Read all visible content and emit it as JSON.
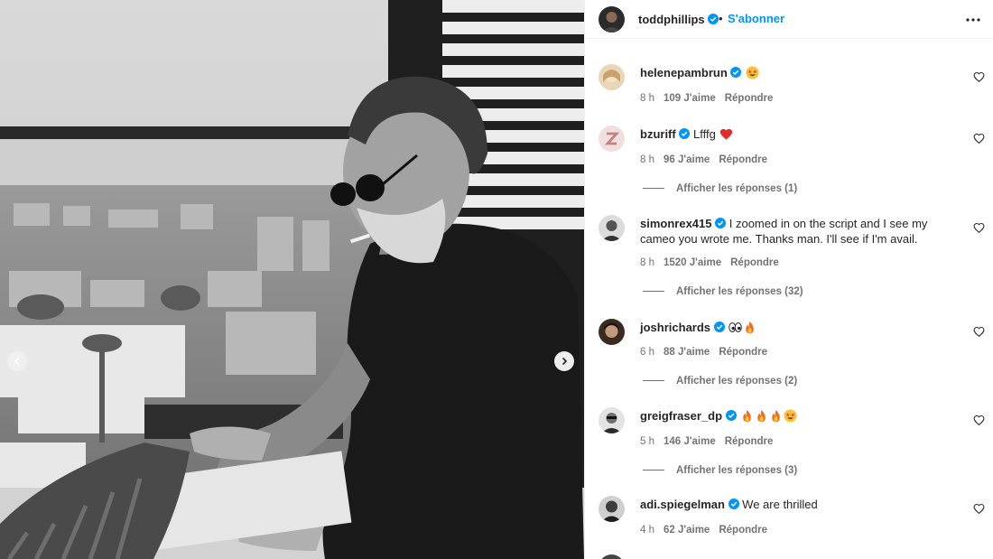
{
  "post": {
    "author": "toddphillips",
    "separator": "•",
    "follow_label": "S'abonner",
    "more_icon": "more-horizontal-icon",
    "carousel": {
      "prev_icon": "chevron-left-icon",
      "next_icon": "chevron-right-icon"
    }
  },
  "comments": [
    {
      "user": "helenepambrun",
      "verified": true,
      "text": "",
      "emojis": [
        "star-struck"
      ],
      "time": "8 h",
      "likes": "109 J'aime",
      "reply": "Répondre",
      "replies": ""
    },
    {
      "user": "bzuriff",
      "verified": true,
      "text": "Lfffg",
      "emojis": [
        "red-heart"
      ],
      "time": "8 h",
      "likes": "96 J'aime",
      "reply": "Répondre",
      "replies": "Afficher les réponses (1)"
    },
    {
      "user": "simonrex415",
      "verified": true,
      "text": "I zoomed in on the script and I see my cameo you wrote me. Thanks man. I'll see if I'm avail.",
      "emojis": [],
      "time": "8 h",
      "likes": "1520 J'aime",
      "reply": "Répondre",
      "replies": "Afficher les réponses (32)"
    },
    {
      "user": "joshrichards",
      "verified": true,
      "text": "",
      "emojis": [
        "eyes",
        "fire"
      ],
      "time": "6 h",
      "likes": "88 J'aime",
      "reply": "Répondre",
      "replies": "Afficher les réponses (2)"
    },
    {
      "user": "greigfraser_dp",
      "verified": true,
      "text": "",
      "emojis": [
        "fire",
        "fire",
        "fire",
        "star-struck"
      ],
      "time": "5 h",
      "likes": "146 J'aime",
      "reply": "Répondre",
      "replies": "Afficher les réponses (3)"
    },
    {
      "user": "adi.spiegelman",
      "verified": true,
      "text": "We are thrilled",
      "emojis": [],
      "time": "4 h",
      "likes": "62 J'aime",
      "reply": "Répondre",
      "replies": ""
    }
  ],
  "colors": {
    "accent": "#0095f6",
    "verified": "#0095f6",
    "muted": "#737373",
    "text": "#262626"
  }
}
